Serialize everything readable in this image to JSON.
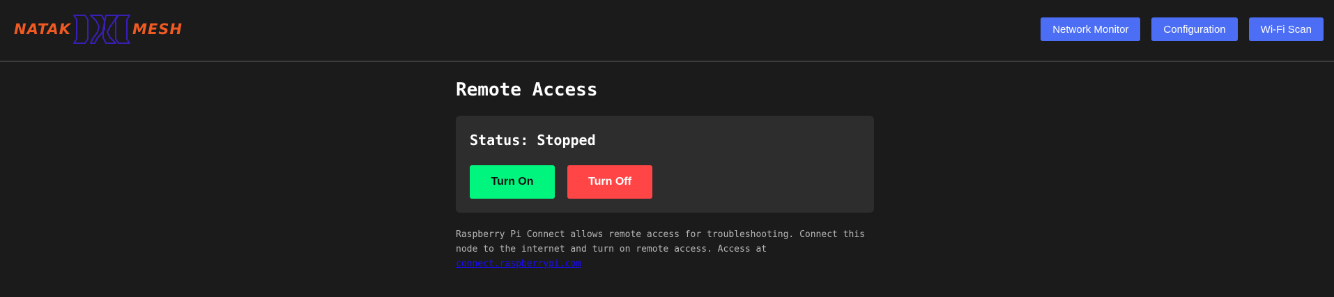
{
  "header": {
    "logo": {
      "left_text": "NATAK",
      "right_text": "MESH",
      "brand_color": "#f05a22",
      "mark_color": "#3a1eb8"
    },
    "nav": [
      {
        "label": "Network Monitor"
      },
      {
        "label": "Configuration"
      },
      {
        "label": "Wi-Fi Scan"
      }
    ],
    "nav_color": "#4c6ef5"
  },
  "main": {
    "title": "Remote Access",
    "status_text": "Status: Stopped",
    "turn_on_label": "Turn On",
    "turn_off_label": "Turn Off",
    "on_color": "#00f57f",
    "off_color": "#ff4545",
    "description": "Raspberry Pi Connect allows remote access for troubleshooting. Connect this node to the internet and turn on remote access. Access at",
    "link_text": "connect.raspberrypi.com"
  }
}
